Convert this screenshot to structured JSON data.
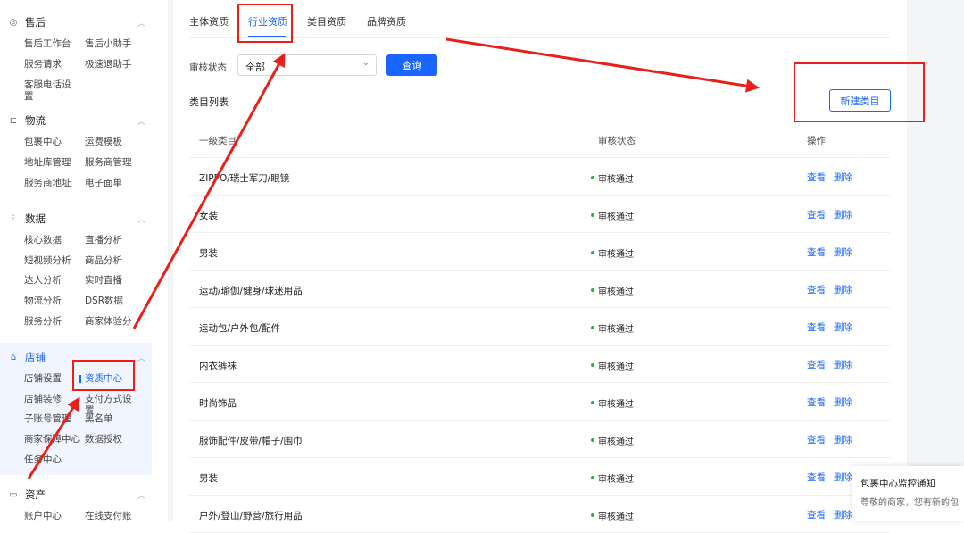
{
  "sidebar": {
    "sections": [
      {
        "title": "售后",
        "icon": "headset-icon",
        "items": [
          "售后工作台",
          "售后小助手",
          "服务请求",
          "极速退助手",
          "客服电话设置"
        ]
      },
      {
        "title": "物流",
        "icon": "truck-icon",
        "items": [
          "包裹中心",
          "运费模板",
          "地址库管理",
          "服务商管理",
          "服务商地址",
          "电子面单"
        ]
      },
      {
        "title": "数据",
        "icon": "chart-icon",
        "items": [
          "核心数据",
          "直播分析",
          "短视频分析",
          "商品分析",
          "达人分析",
          "实时直播",
          "物流分析",
          "DSR数据",
          "服务分析",
          "商家体验分"
        ]
      },
      {
        "title": "店铺",
        "icon": "store-icon",
        "items": [
          "店铺设置",
          "资质中心",
          "店铺装修",
          "支付方式设置",
          "子账号管理",
          "黑名单",
          "商家保障中心",
          "数据授权",
          "任务中心"
        ]
      },
      {
        "title": "资产",
        "icon": "wallet-icon",
        "items": [
          "账户中心",
          "在线支付账"
        ]
      }
    ],
    "active_item": "资质中心"
  },
  "tabs": [
    "主体资质",
    "行业资质",
    "类目资质",
    "品牌资质"
  ],
  "active_tab": "行业资质",
  "filter": {
    "label": "审核状态",
    "value": "全部",
    "query_button": "查询"
  },
  "list": {
    "title": "类目列表",
    "new_button": "新建类目",
    "columns": [
      "一级类目",
      "审核状态",
      "操作"
    ],
    "rows": [
      {
        "category": "ZIPPO/瑞士军刀/眼镜",
        "status": "审核通过"
      },
      {
        "category": "女装",
        "status": "审核通过"
      },
      {
        "category": "男装",
        "status": "审核通过"
      },
      {
        "category": "运动/瑜伽/健身/球迷用品",
        "status": "审核通过"
      },
      {
        "category": "运动包/户外包/配件",
        "status": "审核通过"
      },
      {
        "category": "内衣裤袜",
        "status": "审核通过"
      },
      {
        "category": "时尚饰品",
        "status": "审核通过"
      },
      {
        "category": "服饰配件/皮带/帽子/围巾",
        "status": "审核通过"
      },
      {
        "category": "男装",
        "status": "审核通过"
      },
      {
        "category": "户外/登山/野营/旅行用品",
        "status": "审核通过"
      }
    ],
    "view_label": "查看",
    "delete_label": "删除"
  },
  "notification": {
    "title": "包裹中心监控通知",
    "text": "尊敬的商家，您有新的包"
  },
  "colors": {
    "accent": "#1966ff",
    "status_dot": "#27b148",
    "annotation": "#e8201a"
  }
}
